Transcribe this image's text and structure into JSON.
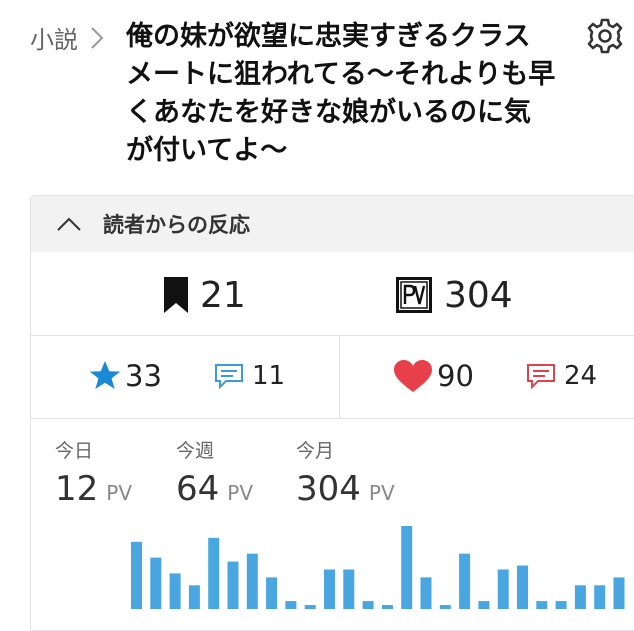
{
  "breadcrumb": {
    "section": "小説"
  },
  "novel": {
    "title": "俺の妹が欲望に忠実すぎるクラスメートに狙われてる〜それよりも早くあなたを好きな娘がいるのに気が付いてよ〜"
  },
  "reactions": {
    "heading": "読者からの反応",
    "bookmarks": "21",
    "pageviews": "304",
    "stars": "33",
    "star_comments": "11",
    "hearts": "90",
    "heart_comments": "24"
  },
  "periods": [
    {
      "label": "今日",
      "value": "12",
      "unit": "PV"
    },
    {
      "label": "今週",
      "value": "64",
      "unit": "PV"
    },
    {
      "label": "今月",
      "value": "304",
      "unit": "PV"
    }
  ],
  "colors": {
    "bar": "#4aa6e0",
    "star": "#1a8ad6",
    "heart": "#e8404a",
    "comment_blue": "#3b9be0",
    "comment_red": "#e8404a"
  },
  "chart_data": {
    "type": "bar",
    "values": [
      17,
      13,
      9,
      6,
      18,
      12,
      14,
      8,
      2,
      1,
      10,
      10,
      2,
      1,
      21,
      8,
      1,
      14,
      2,
      10,
      11,
      2,
      2,
      6,
      6,
      8
    ]
  }
}
